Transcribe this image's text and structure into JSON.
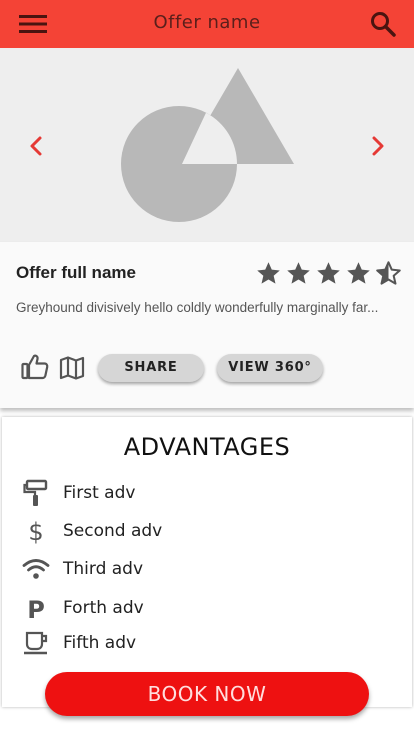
{
  "colors": {
    "app_bar": "#f44336",
    "accent_red": "#ee1111",
    "arrow_red": "#e53935",
    "placeholder_gray": "#b8b8b8",
    "icon_gray": "#555555"
  },
  "header": {
    "title": "Offer name",
    "menu_icon": "hamburger-menu-icon",
    "search_icon": "search-icon"
  },
  "gallery": {
    "prev_icon": "chevron-left-icon",
    "next_icon": "chevron-right-icon",
    "image": "placeholder-shapes-image"
  },
  "offer": {
    "full_name": "Offer full name",
    "description": "Greyhound divisively hello coldly wonderfully marginally far...",
    "rating": 4.5,
    "rating_max": 5
  },
  "actions": {
    "like_icon": "thumbs-up-icon",
    "map_icon": "map-icon",
    "share_label": "SHARE",
    "view360_label": "VIEW 360°"
  },
  "advantages": {
    "title": "ADVANTAGES",
    "items": [
      {
        "icon": "paint-roller-icon",
        "label": "First adv"
      },
      {
        "icon": "dollar-icon",
        "label": "Second adv"
      },
      {
        "icon": "wifi-icon",
        "label": "Third adv"
      },
      {
        "icon": "parking-icon",
        "label": "Forth adv"
      },
      {
        "icon": "coffee-cup-icon",
        "label": "Fifth adv"
      }
    ]
  },
  "book_button": {
    "label": "BOOK NOW"
  }
}
